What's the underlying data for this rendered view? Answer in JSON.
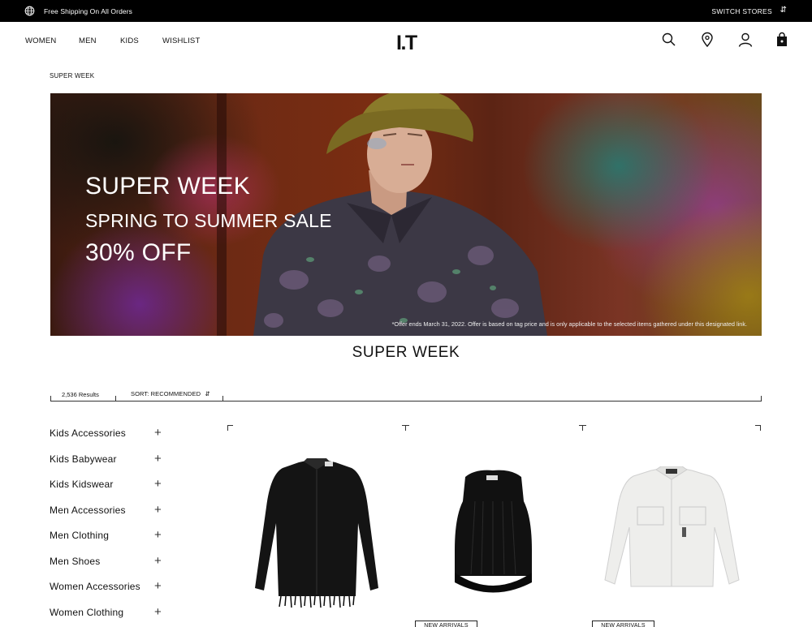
{
  "topbar": {
    "globe_icon": "globe-icon",
    "shipping_text": "Free Shipping On All Orders",
    "switch_stores_label": "SWITCH STORES",
    "swap_icon": "swap-arrows-icon"
  },
  "header": {
    "nav": [
      "WOMEN",
      "MEN",
      "KIDS",
      "WISHLIST"
    ],
    "logo": "I.T",
    "icons": [
      "search-icon",
      "location-pin-icon",
      "user-icon",
      "bag-icon"
    ]
  },
  "breadcrumb": "SUPER WEEK",
  "hero": {
    "line1": "SUPER WEEK",
    "line2": "SPRING TO SUMMER SALE",
    "line3": "30% OFF",
    "disclaimer": "*Offer ends March 31, 2022. Offer is based on tag price and is only applicable to the selected items gathered under this designated link."
  },
  "section_title": "SUPER WEEK",
  "results": {
    "count": "2,536 Results",
    "sort_label": "SORT: RECOMMENDED",
    "sort_icon": "sort-arrows-icon"
  },
  "categories": [
    "Kids Accessories",
    "Kids Babywear",
    "Kids Kidswear",
    "Men Accessories",
    "Men Clothing",
    "Men Shoes",
    "Women Accessories",
    "Women Clothing"
  ],
  "products": [
    {
      "image": "black-fringe-shirt",
      "badge": ""
    },
    {
      "image": "black-sleeveless-top",
      "badge": "NEW ARRIVALS"
    },
    {
      "image": "white-overshirt",
      "badge": "NEW ARRIVALS"
    }
  ],
  "colors": {
    "topbar_bg": "#000000",
    "text": "#111111"
  }
}
